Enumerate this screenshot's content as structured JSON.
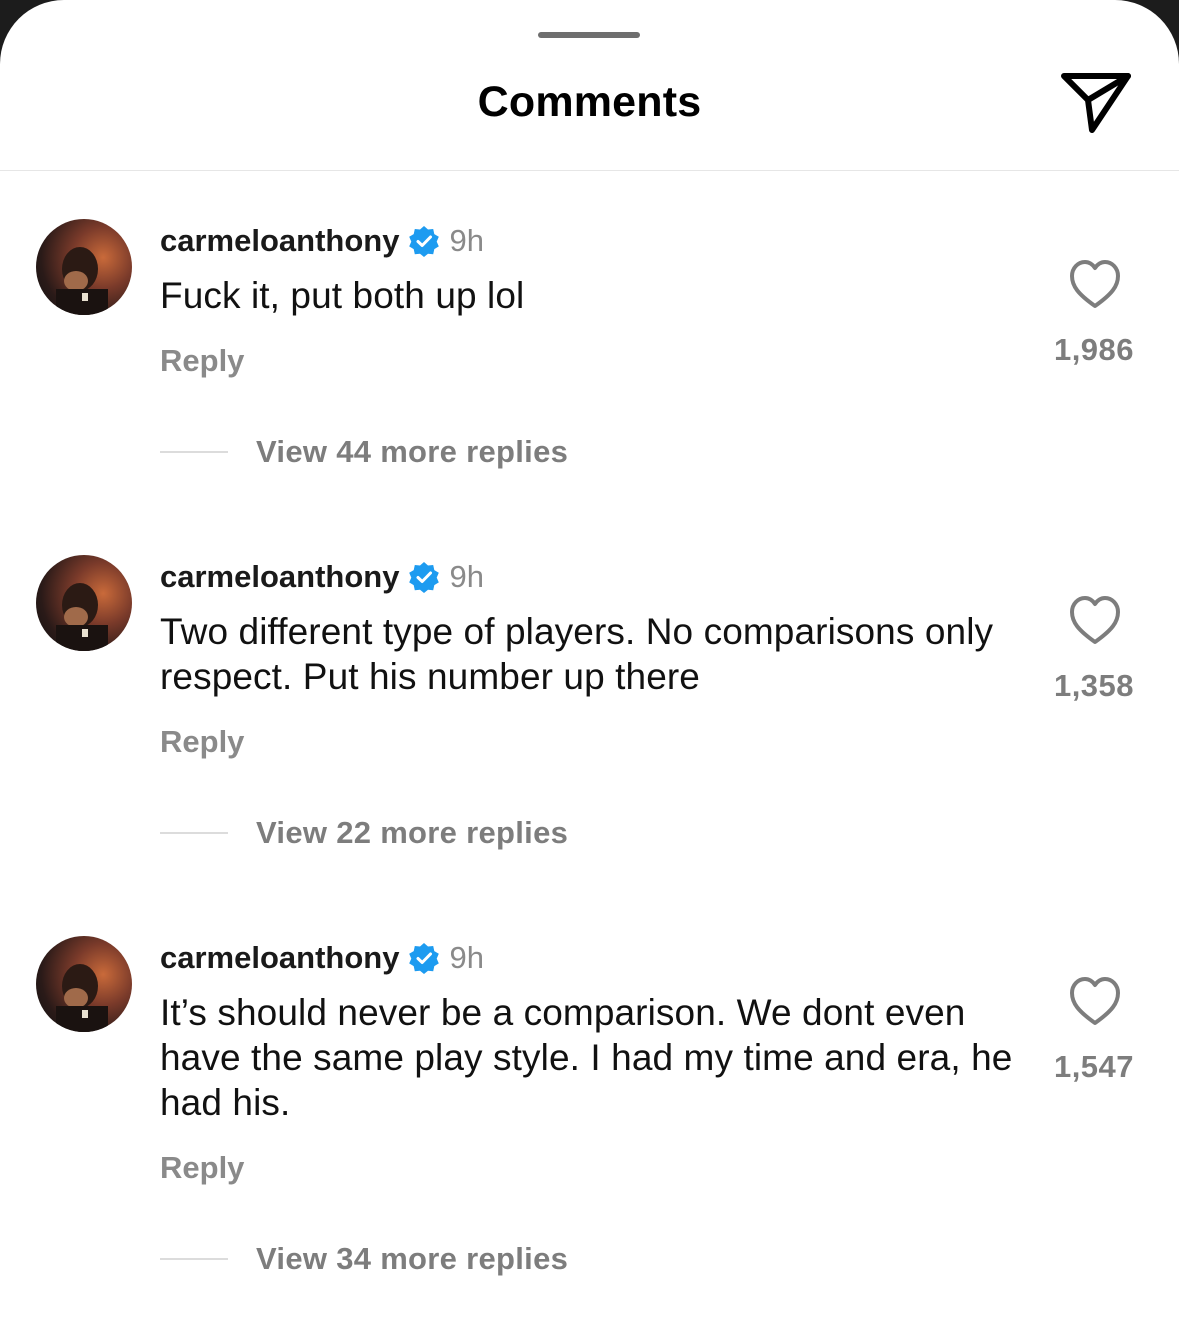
{
  "header": {
    "title": "Comments"
  },
  "comments": [
    {
      "username": "carmeloanthony",
      "time": "9h",
      "text": "Fuck it, put both up lol",
      "reply_label": "Reply",
      "likes": "1,986",
      "view_replies": "View 44 more replies"
    },
    {
      "username": "carmeloanthony",
      "time": "9h",
      "text": "Two different type of players. No comparisons only respect. Put his number up there",
      "reply_label": "Reply",
      "likes": "1,358",
      "view_replies": "View 22 more replies"
    },
    {
      "username": "carmeloanthony",
      "time": "9h",
      "text": "It’s should never be a comparison. We dont even have the same play style. I had my time and era, he had his.",
      "reply_label": "Reply",
      "likes": "1,547",
      "view_replies": "View 34 more replies"
    }
  ],
  "colors": {
    "verified_badge": "#1d9bf0",
    "secondary_text": "#8a8a8a"
  },
  "icons": {
    "share": "paper-plane-icon",
    "like": "heart-outline-icon",
    "verified": "verified-badge-icon"
  }
}
